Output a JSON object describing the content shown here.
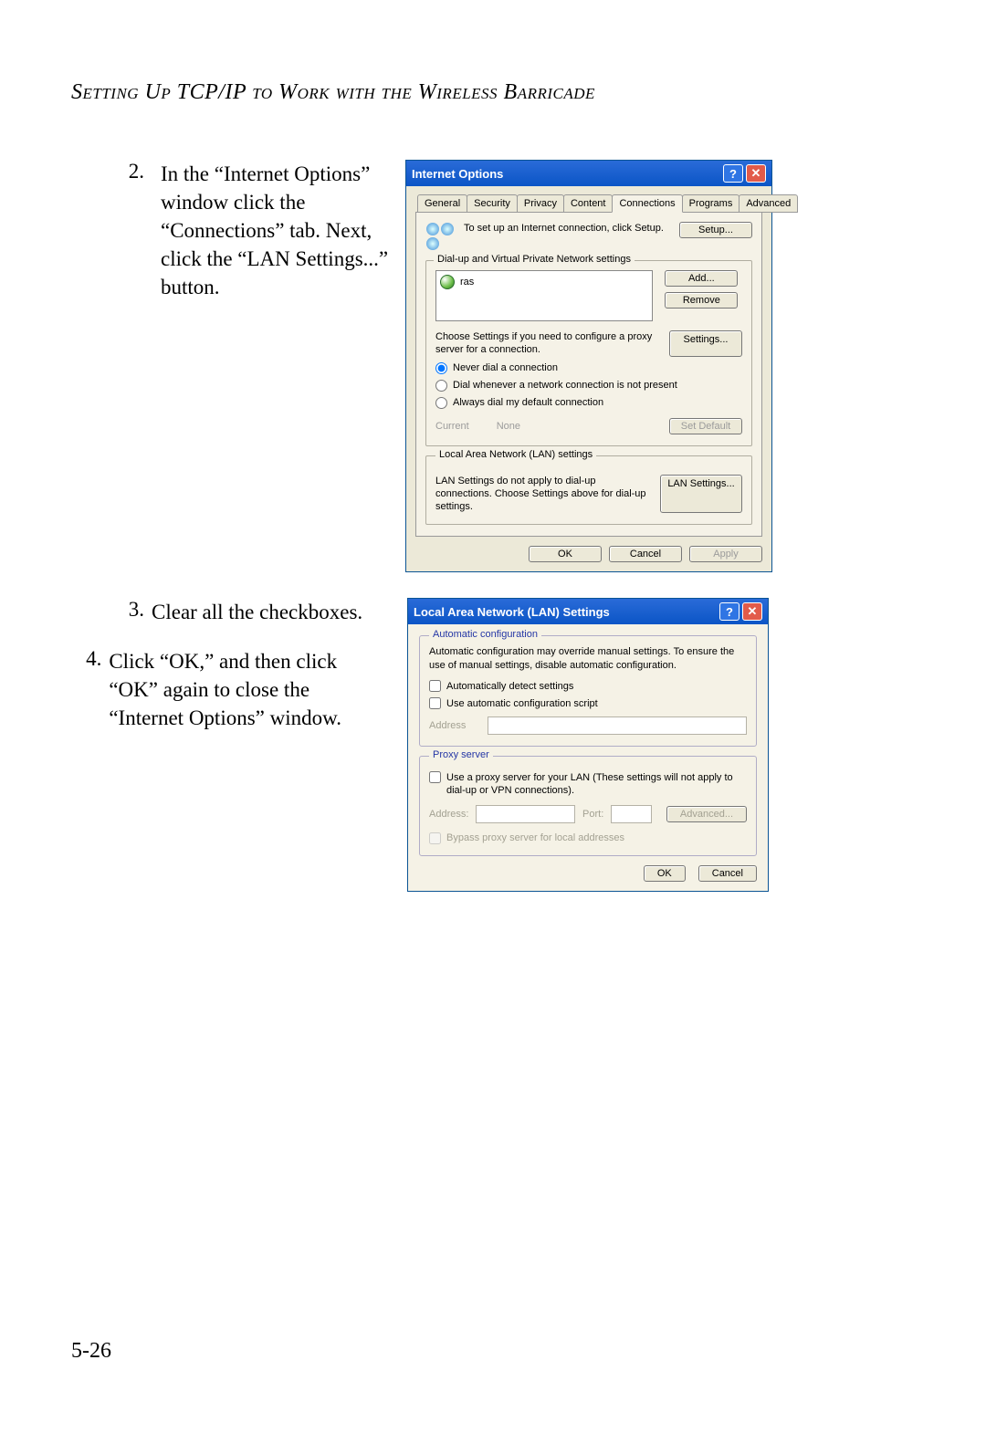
{
  "title": "Setting Up TCP/IP to Work with the Wireless Barricade",
  "page_number": "5-26",
  "steps": {
    "s2_num": "2.",
    "s2_text": "In the “Internet Options” window click the “Connections” tab. Next, click the “LAN Settings...” button.",
    "s3_num": "3.",
    "s3_text": "Clear all the checkboxes.",
    "s4_num": "4.",
    "s4_text": "Click “OK,” and then click “OK” again to close the “Internet Options” window."
  },
  "dlg1": {
    "title": "Internet Options",
    "tabs": [
      "General",
      "Security",
      "Privacy",
      "Content",
      "Connections",
      "Programs",
      "Advanced"
    ],
    "setup_text": "To set up an Internet connection, click Setup.",
    "btn_setup": "Setup...",
    "grp_dialup": "Dial-up and Virtual Private Network settings",
    "ras_item": "ras",
    "btn_add": "Add...",
    "btn_remove": "Remove",
    "choose_text": "Choose Settings if you need to configure a proxy server for a connection.",
    "btn_settings": "Settings...",
    "r_never": "Never dial a connection",
    "r_dialwhen": "Dial whenever a network connection is not present",
    "r_always": "Always dial my default connection",
    "current_lbl": "Current",
    "current_val": "None",
    "btn_setdef": "Set Default",
    "grp_lan": "Local Area Network (LAN) settings",
    "lan_text": "LAN Settings do not apply to dial-up connections. Choose Settings above for dial-up settings.",
    "btn_lan": "LAN Settings...",
    "ok": "OK",
    "cancel": "Cancel",
    "apply": "Apply"
  },
  "dlg2": {
    "title": "Local Area Network (LAN) Settings",
    "fs1_title": "Automatic configuration",
    "fs1_text": "Automatic configuration may override manual settings.  To ensure the use of manual settings, disable automatic configuration.",
    "chk_auto": "Automatically detect settings",
    "chk_script": "Use automatic configuration script",
    "addr_lbl": "Address",
    "fs2_title": "Proxy server",
    "chk_proxy": "Use a proxy server for your LAN (These settings will not apply to dial-up or VPN connections).",
    "addr2_lbl": "Address:",
    "port_lbl": "Port:",
    "advanced": "Advanced...",
    "chk_bypass": "Bypass proxy server for local addresses",
    "ok": "OK",
    "cancel": "Cancel"
  }
}
